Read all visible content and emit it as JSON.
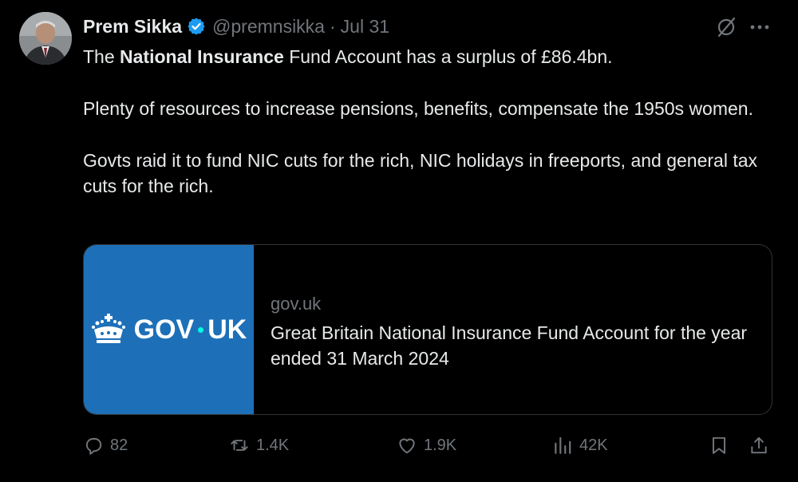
{
  "colors": {
    "background": "#000000",
    "text_primary": "#e7e9ea",
    "text_secondary": "#71767b",
    "verified": "#1d9bf0",
    "govuk_blue": "#1d70b8",
    "card_border": "#2f3336"
  },
  "author": {
    "display_name": "Prem Sikka",
    "handle": "@premnsikka",
    "separator": "·",
    "date": "Jul 31",
    "verified_icon": "verified-badge-icon",
    "avatar": "avatar"
  },
  "tweet": {
    "line1_prefix": "The ",
    "line1_bold": "National Insurance",
    "line1_suffix": " Fund Account has a surplus of £86.4bn.",
    "paragraph2": "Plenty of resources to increase pensions, benefits, compensate the 1950s women.",
    "paragraph3": "Govts raid it to fund NIC cuts for the rich, NIC holidays in freeports, and general tax cuts for the rich."
  },
  "card": {
    "logo_left": "GOV",
    "logo_right": "UK",
    "domain": "gov.uk",
    "title": "Great Britain National Insurance Fund Account for the year ended 31 March 2024"
  },
  "actions": {
    "replies": "82",
    "reposts": "1.4K",
    "likes": "1.9K",
    "views": "42K",
    "icons": [
      "reply-icon",
      "repost-icon",
      "like-icon",
      "views-icon",
      "bookmark-icon",
      "share-icon"
    ]
  },
  "header_icons": [
    "grok-icon",
    "more-icon"
  ]
}
